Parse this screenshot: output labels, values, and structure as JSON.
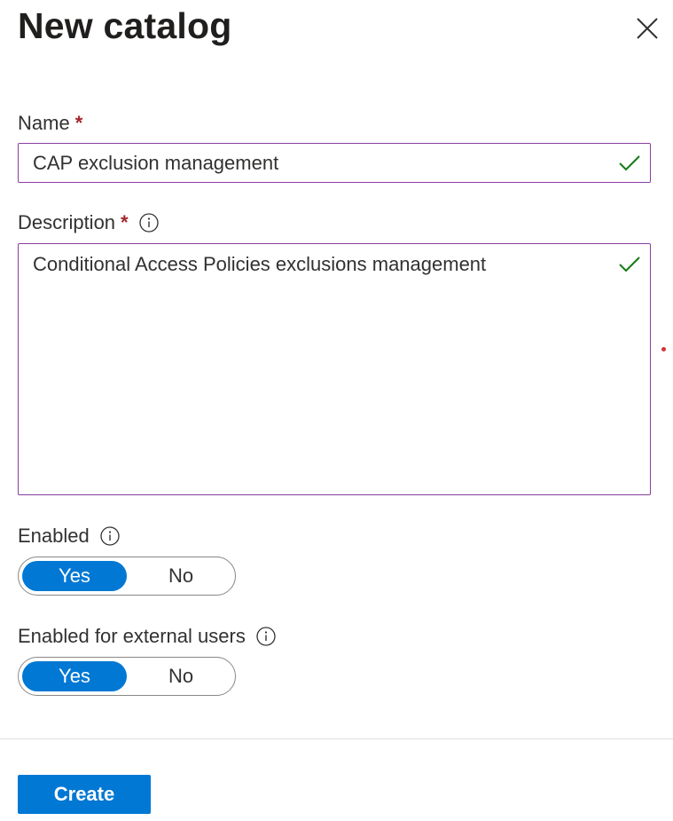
{
  "panel": {
    "title": "New catalog"
  },
  "fields": {
    "name": {
      "label": "Name",
      "required_mark": "*",
      "value": "CAP exclusion management"
    },
    "description": {
      "label": "Description",
      "required_mark": "*",
      "value": "Conditional Access Policies exclusions management"
    },
    "enabled": {
      "label": "Enabled",
      "yes_label": "Yes",
      "no_label": "No",
      "selected": "Yes"
    },
    "external": {
      "label": "Enabled for external users",
      "yes_label": "Yes",
      "no_label": "No",
      "selected": "Yes"
    }
  },
  "footer": {
    "create_label": "Create"
  },
  "colors": {
    "accent": "#0078d4",
    "input_border": "#8a3d9e",
    "required": "#a4262c",
    "valid_check": "#107c10"
  },
  "icons": {
    "close": "close-icon",
    "info": "info-icon",
    "check": "checkmark-icon"
  }
}
